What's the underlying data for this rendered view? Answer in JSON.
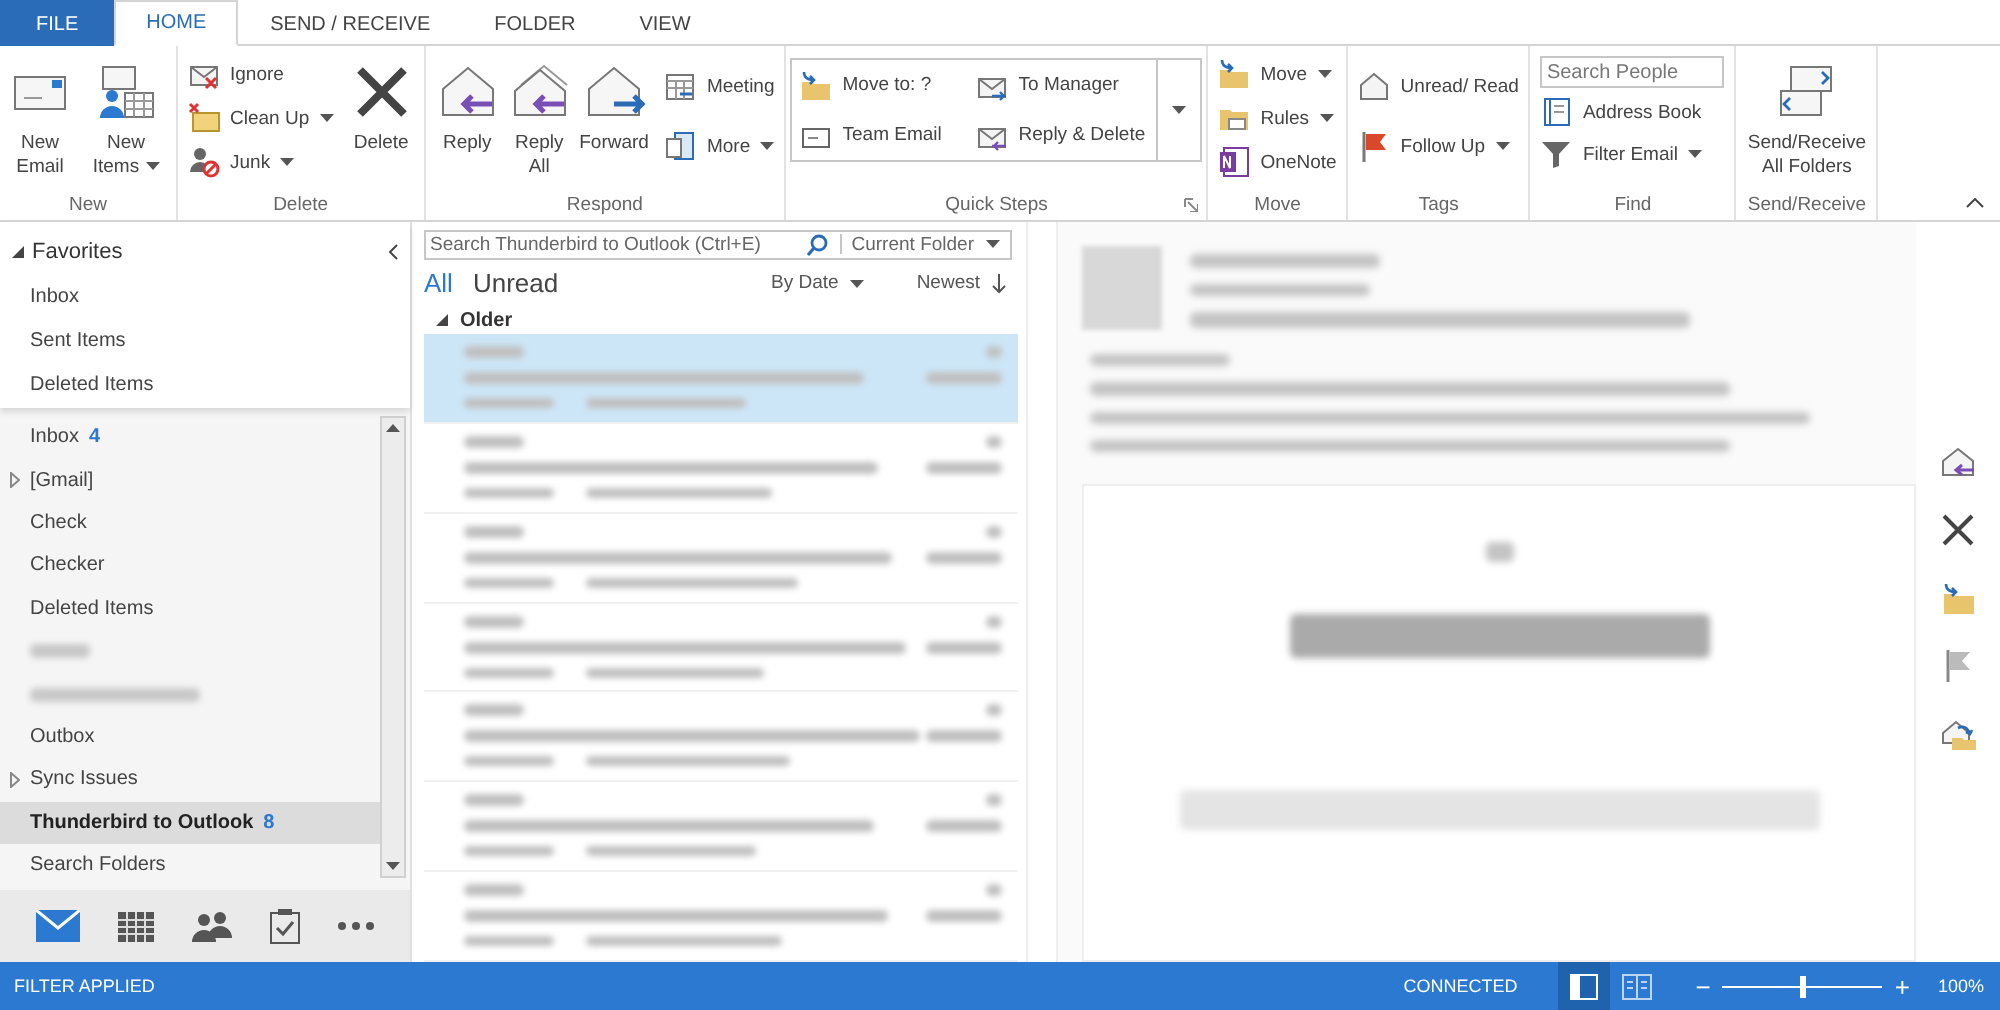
{
  "tabs": [
    {
      "label": "FILE",
      "kind": "backstage",
      "selected": false
    },
    {
      "label": "HOME",
      "kind": "tab",
      "selected": true
    },
    {
      "label": "SEND / RECEIVE",
      "kind": "tab",
      "selected": false
    },
    {
      "label": "FOLDER",
      "kind": "tab",
      "selected": false
    },
    {
      "label": "VIEW",
      "kind": "tab",
      "selected": false
    }
  ],
  "ribbon": {
    "groups": [
      {
        "label": "New",
        "items": [
          {
            "kind": "large",
            "label": "New Email",
            "dropdown": false
          },
          {
            "kind": "large",
            "label": "New Items",
            "dropdown": true
          }
        ]
      },
      {
        "label": "Delete",
        "items": [
          {
            "kind": "small",
            "label": "Ignore",
            "dropdown": false
          },
          {
            "kind": "small",
            "label": "Clean Up",
            "dropdown": true
          },
          {
            "kind": "small",
            "label": "Junk",
            "dropdown": true
          },
          {
            "kind": "large",
            "label": "Delete",
            "dropdown": false
          }
        ]
      },
      {
        "label": "Respond",
        "items": [
          {
            "kind": "large",
            "label": "Reply",
            "dropdown": false
          },
          {
            "kind": "large",
            "label": "Reply All",
            "dropdown": false
          },
          {
            "kind": "large",
            "label": "Forward",
            "dropdown": false
          },
          {
            "kind": "small",
            "label": "Meeting",
            "dropdown": false
          },
          {
            "kind": "small",
            "label": "More",
            "dropdown": true
          }
        ]
      },
      {
        "label": "Quick Steps",
        "launcher": true,
        "items": [
          {
            "kind": "gallery",
            "items": [
              {
                "label": "Move to: ?"
              },
              {
                "label": "To Manager"
              },
              {
                "label": "Team Email"
              },
              {
                "label": "Reply & Delete"
              }
            ]
          }
        ]
      },
      {
        "label": "Move",
        "items": [
          {
            "kind": "small",
            "label": "Move",
            "dropdown": true
          },
          {
            "kind": "small",
            "label": "Rules",
            "dropdown": true
          },
          {
            "kind": "small",
            "label": "OneNote",
            "dropdown": false
          }
        ]
      },
      {
        "label": "Tags",
        "items": [
          {
            "kind": "small",
            "label": "Unread/ Read",
            "dropdown": false
          },
          {
            "kind": "small",
            "label": "Follow Up",
            "dropdown": true
          }
        ]
      },
      {
        "label": "Find",
        "items": [
          {
            "kind": "search",
            "placeholder": "Search People"
          },
          {
            "kind": "small",
            "label": "Address Book",
            "dropdown": false
          },
          {
            "kind": "small",
            "label": "Filter Email",
            "dropdown": true
          }
        ]
      },
      {
        "label": "Send/Receive",
        "items": [
          {
            "kind": "large",
            "label": "Send/Receive All Folders",
            "dropdown": false
          }
        ]
      }
    ]
  },
  "favorites": {
    "label": "Favorites",
    "expanded": true,
    "items": [
      {
        "label": "Inbox",
        "selected": false
      },
      {
        "label": "Sent Items",
        "selected": false
      },
      {
        "label": "Deleted Items",
        "selected": false
      }
    ]
  },
  "folders": [
    {
      "kind": "folder",
      "label": "Inbox",
      "count": "4",
      "selected": false
    },
    {
      "kind": "folder",
      "label": "[Gmail]",
      "expanded": false,
      "selected": false
    },
    {
      "kind": "folder",
      "label": "Check",
      "selected": false
    },
    {
      "kind": "folder",
      "label": "Checker",
      "selected": false
    },
    {
      "kind": "folder",
      "label": "Deleted Items",
      "selected": false
    },
    {
      "kind": "blurred",
      "selected": false
    },
    {
      "kind": "blurred",
      "selected": false
    },
    {
      "kind": "folder",
      "label": "Outbox",
      "selected": false
    },
    {
      "kind": "folder",
      "label": "Sync Issues",
      "expanded": false,
      "selected": false
    },
    {
      "kind": "folder",
      "label": "Thunderbird to Outlook",
      "count": "8",
      "selected": true
    },
    {
      "kind": "folder",
      "label": "Search Folders",
      "selected": false
    }
  ],
  "navigation": [
    {
      "selected": true
    },
    {
      "selected": false
    },
    {
      "selected": false
    },
    {
      "selected": false
    },
    {
      "selected": false
    }
  ],
  "message_list": {
    "search": {
      "placeholder": "Search Thunderbird to Outlook (Ctrl+E)"
    },
    "scope": "Current Folder",
    "filters": [
      {
        "label": "All",
        "selected": true
      },
      {
        "label": "Unread",
        "selected": false
      }
    ],
    "sort": "By Date",
    "order": "Newest",
    "group": {
      "label": "Older",
      "expanded": true
    },
    "messages": [
      {
        "selected": true
      },
      {
        "selected": false
      },
      {
        "selected": false
      },
      {
        "selected": false
      },
      {
        "selected": false
      },
      {
        "selected": false
      },
      {
        "selected": false
      }
    ]
  },
  "status_bar": {
    "filter": "FILTER APPLIED",
    "connection": "CONNECTED",
    "views": [
      {
        "selected": true
      },
      {
        "selected": false
      }
    ],
    "zoom": {
      "minus": "−",
      "plus": "+",
      "level": 0.5,
      "reading": "100%"
    }
  }
}
